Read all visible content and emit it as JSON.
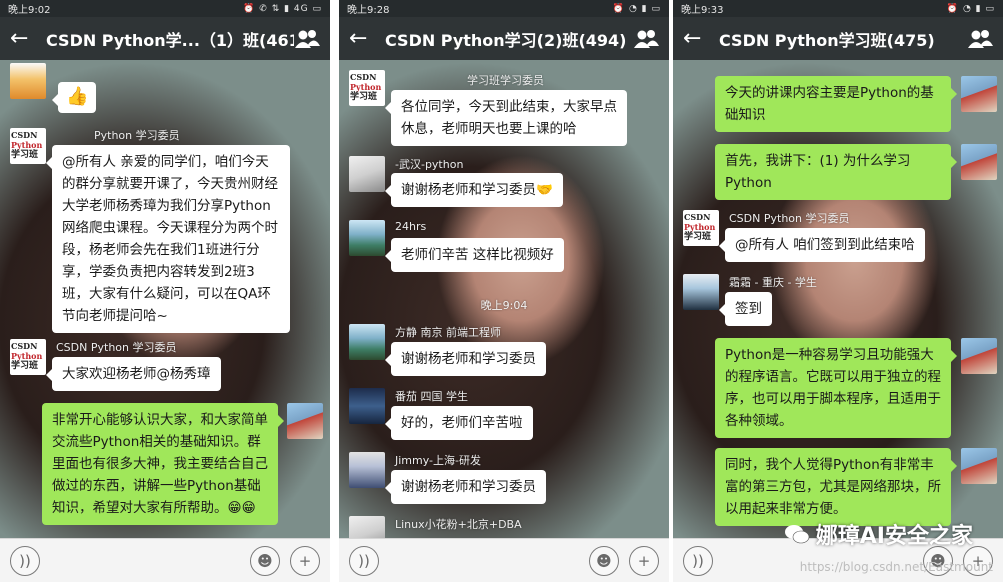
{
  "colors": {
    "bubble_self": "#a0e75a",
    "bubble_other": "#ffffff",
    "titlebar": "#2f3436",
    "statusbar": "#262b2d"
  },
  "phones": [
    {
      "status": {
        "time": "晚上9:02",
        "network": "4G"
      },
      "title": "CSDN Python学...（1）班(461)",
      "messages": [
        {
          "sender": "",
          "text": "👍"
        },
        {
          "sender": "Python 学习委员",
          "text": "@所有人 亲爱的同学们，咱们今天的群分享就要开课了，今天贵州财经大学老师杨秀璋为我们分享Python网络爬虫课程。今天课程分为两个时段，杨老师会先在我们1班进行分享，学委负责把内容转发到2班3班，大家有什么疑问，可以在QA环节向老师提问哈~"
        },
        {
          "sender": "CSDN Python 学习委员",
          "text": "大家欢迎杨老师@杨秀璋"
        },
        {
          "sender": "",
          "text": "非常开心能够认识大家，和大家简单交流些Python相关的基础知识。群里面也有很多大神，我主要结合自己做过的东西，讲解一些Python基础知识，希望对大家有所帮助。😁😁"
        }
      ]
    },
    {
      "status": {
        "time": "晚上9:28"
      },
      "title": "CSDN Python学习(2)班(494)",
      "messages": [
        {
          "sender": "学习班学习委员",
          "text": "各位同学，今天到此结束，大家早点休息，老师明天也要上课的哈"
        },
        {
          "sender": "-武汉-python",
          "text": "谢谢杨老师和学习委员🤝"
        },
        {
          "sender": "24hrs",
          "text": "老师们辛苦 这样比视频好"
        },
        {
          "sender": "方静 南京 前端工程师",
          "text": "谢谢杨老师和学习委员"
        },
        {
          "sender": "番茄 四国 学生",
          "text": "好的，老师们辛苦啦"
        },
        {
          "sender": "Jimmy-上海-研发",
          "text": "谢谢杨老师和学习委员"
        },
        {
          "sender": "Linux小花粉+北京+DBA",
          "text": ""
        }
      ],
      "timestamp": "晚上9:04"
    },
    {
      "status": {
        "time": "晚上9:33"
      },
      "title": "CSDN Python学习班(475)",
      "messages": [
        {
          "sender": "",
          "text": "今天的讲课内容主要是Python的基础知识"
        },
        {
          "sender": "",
          "text": "首先，我讲下：(1) 为什么学习Python"
        },
        {
          "sender": "CSDN Python 学习委员",
          "text": "@所有人 咱们签到到此结束哈"
        },
        {
          "sender": "霜霜 - 重庆 - 学生",
          "text": "签到"
        },
        {
          "sender": "",
          "text": "Python是一种容易学习且功能强大的程序语言。它既可以用于独立的程序，也可以用于脚本程序，且适用于各种领域。"
        },
        {
          "sender": "",
          "text": "同时，我个人觉得Python有非常丰富的第三方包，尤其是网络那块，所以用起来非常方便。"
        }
      ]
    }
  ],
  "avatars": {
    "csdn_line1": "CSDN",
    "csdn_line2": "Python",
    "csdn_line3": "学习班"
  },
  "watermark": "娜璋AI安全之家",
  "url": "https://blog.csdn.net/Eastmount"
}
